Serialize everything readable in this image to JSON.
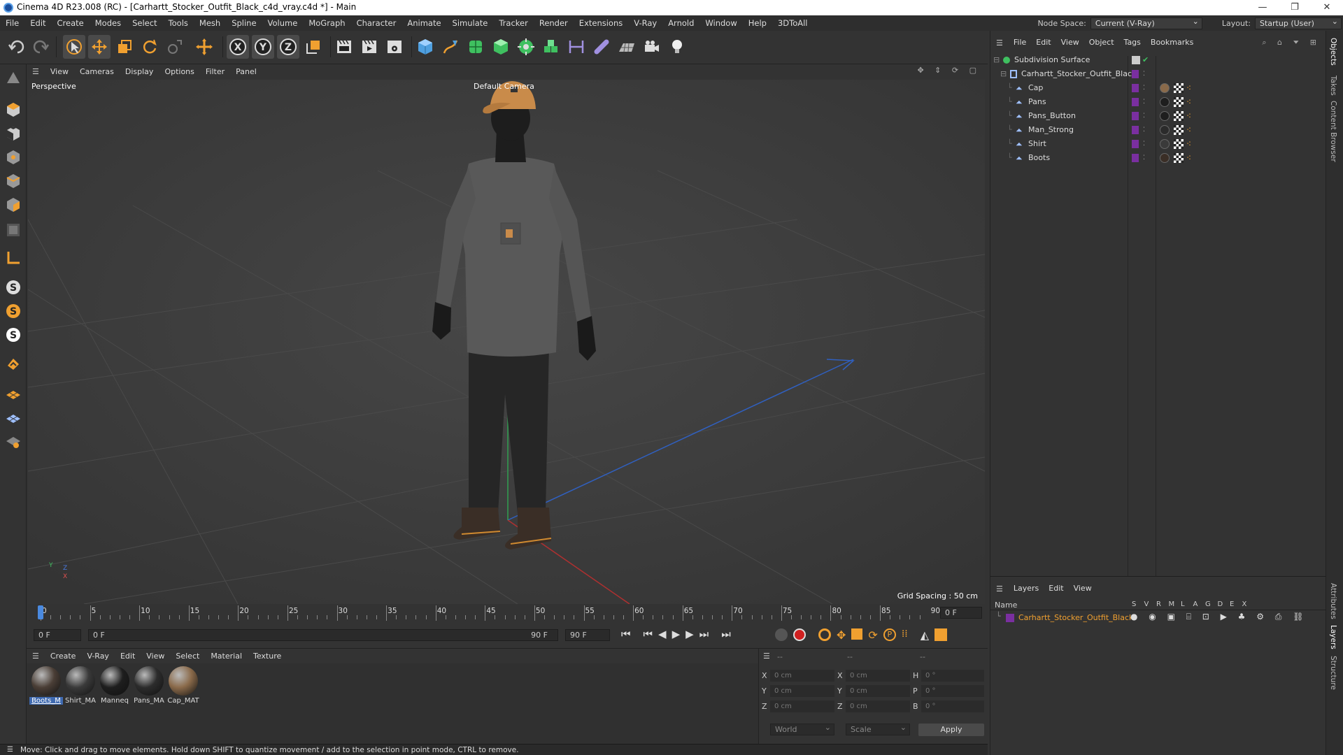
{
  "window": {
    "title": "Cinema 4D R23.008 (RC) - [Carhartt_Stocker_Outfit_Black_c4d_vray.c4d *] - Main",
    "controls": [
      "—",
      "❐",
      "✕"
    ]
  },
  "menubar": {
    "items": [
      "File",
      "Edit",
      "Create",
      "Modes",
      "Select",
      "Tools",
      "Mesh",
      "Spline",
      "Volume",
      "MoGraph",
      "Character",
      "Animate",
      "Simulate",
      "Tracker",
      "Render",
      "Extensions",
      "V-Ray",
      "Arnold",
      "Window",
      "Help",
      "3DToAll"
    ],
    "node_space_label": "Node Space:",
    "node_space_value": "Current (V-Ray)",
    "layout_label": "Layout:",
    "layout_value": "Startup (User)"
  },
  "viewport": {
    "menu": [
      "View",
      "Cameras",
      "Display",
      "Options",
      "Filter",
      "Panel"
    ],
    "view_name": "Perspective",
    "camera": "Default Camera",
    "grid_spacing": "Grid Spacing : 50 cm",
    "axis_x": "X",
    "axis_y": "Y",
    "axis_z": "Z"
  },
  "timeline": {
    "ticks": [
      "0",
      "5",
      "10",
      "15",
      "20",
      "25",
      "30",
      "35",
      "40",
      "45",
      "50",
      "55",
      "60",
      "65",
      "70",
      "75",
      "80",
      "85",
      "90"
    ],
    "current_frame": "0 F",
    "start_frame": "0 F",
    "range_start": "0 F",
    "range_end": "90 F",
    "end_frame": "90 F"
  },
  "materials": {
    "menu": [
      "Create",
      "V-Ray",
      "Edit",
      "View",
      "Select",
      "Material",
      "Texture"
    ],
    "items": [
      {
        "name": "Boots_M",
        "color": "#4a3e36"
      },
      {
        "name": "Shirt_MA",
        "color": "#3a3a3a"
      },
      {
        "name": "Manneq",
        "color": "#1e1e1e"
      },
      {
        "name": "Pans_MA",
        "color": "#2c2c2c"
      },
      {
        "name": "Cap_MAT",
        "color": "#8a6a4a"
      }
    ]
  },
  "coords": {
    "headers": [
      "--",
      "--",
      "--"
    ],
    "rows": [
      {
        "a": "X",
        "av": "0 cm",
        "b": "X",
        "bv": "0 cm",
        "c": "H",
        "cv": "0 °"
      },
      {
        "a": "Y",
        "av": "0 cm",
        "b": "Y",
        "bv": "0 cm",
        "c": "P",
        "cv": "0 °"
      },
      {
        "a": "Z",
        "av": "0 cm",
        "b": "Z",
        "bv": "0 cm",
        "c": "B",
        "cv": "0 °"
      }
    ],
    "mode1": "World",
    "mode2": "Scale",
    "apply": "Apply"
  },
  "status": {
    "text": "Move: Click and drag to move elements. Hold down SHIFT to quantize movement / add to the selection in point mode, CTRL to remove."
  },
  "objects": {
    "menu": [
      "File",
      "Edit",
      "View",
      "Object",
      "Tags",
      "Bookmarks"
    ],
    "root": "Subdivision Surface",
    "group": "Carhartt_Stocker_Outfit_Black",
    "children": [
      "Cap",
      "Pans",
      "Pans_Button",
      "Man_Strong",
      "Shirt",
      "Boots"
    ]
  },
  "layers": {
    "menu": [
      "Layers",
      "Edit",
      "View"
    ],
    "header_name": "Name",
    "columns": [
      "S",
      "V",
      "R",
      "M",
      "L",
      "A",
      "G",
      "D",
      "E",
      "X"
    ],
    "layer_name": "Carhartt_Stocker_Outfit_Black"
  },
  "sidetabs": {
    "top": [
      "Objects",
      "Takes",
      "Content Browser"
    ],
    "bottom": [
      "Attributes",
      "Layers",
      "Structure"
    ]
  },
  "colors": {
    "accent_orange": "#f0a030",
    "layer_purple": "#7a2fa0",
    "selection_blue": "#3f6ab0"
  }
}
